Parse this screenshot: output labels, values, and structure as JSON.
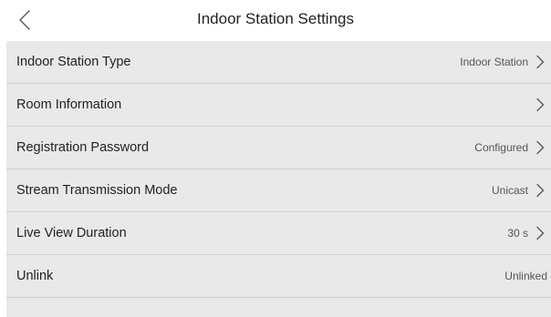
{
  "header": {
    "back_icon": "chevron-left-icon",
    "title": "Indoor Station Settings"
  },
  "settings": {
    "indoor_station_type": {
      "label": "Indoor Station Type",
      "value": "Indoor Station"
    },
    "room_information": {
      "label": "Room Information",
      "value": ""
    },
    "registration_password": {
      "label": "Registration Password",
      "value": "Configured"
    },
    "stream_transmission_mode": {
      "label": "Stream Transmission Mode",
      "value": "Unicast"
    },
    "live_view_duration": {
      "label": "Live View Duration",
      "value": "30 s"
    },
    "unlink": {
      "label": "Unlink",
      "value": "Unlinked"
    }
  },
  "icons": {
    "row_chevron": "chevron-right-icon"
  },
  "colors": {
    "list_background": "#e9e9e9",
    "divider": "#d0d0d0",
    "text_primary": "#222222",
    "text_secondary": "#555555"
  }
}
